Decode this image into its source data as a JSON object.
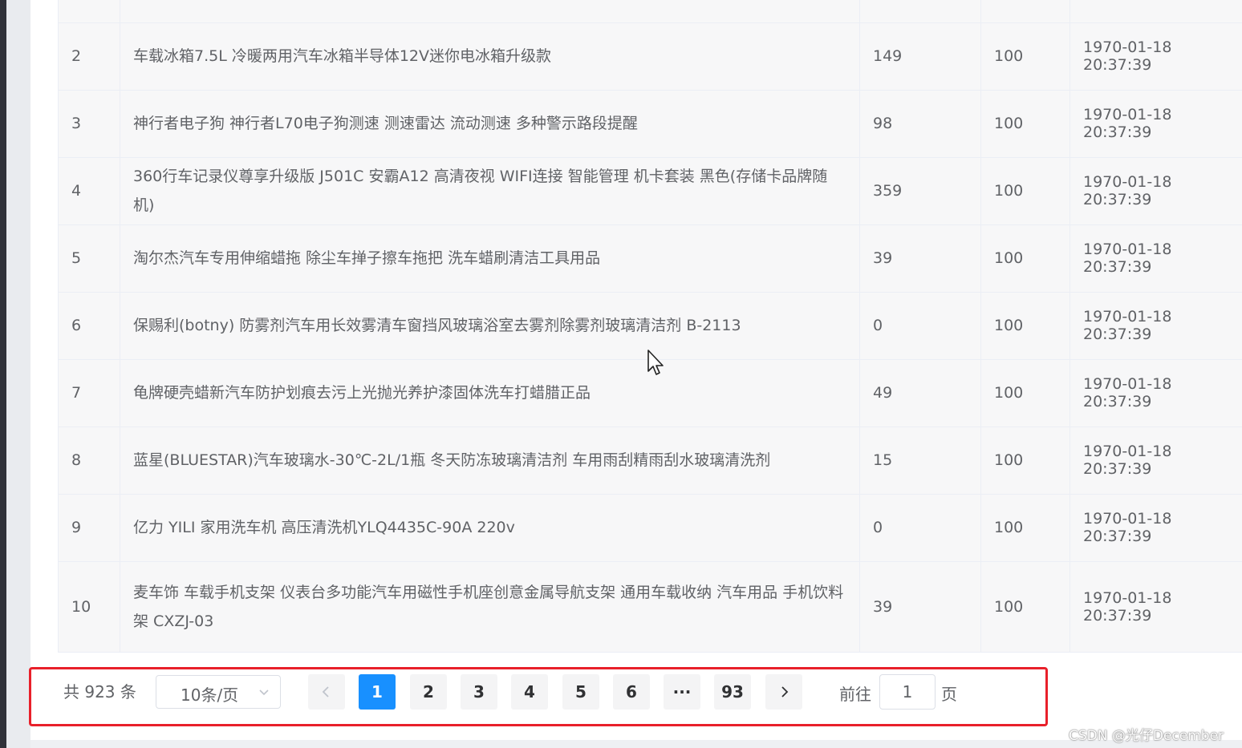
{
  "table": {
    "rows": [
      {
        "idx": "",
        "name": "",
        "price": "",
        "stock": "",
        "time": ""
      },
      {
        "idx": "2",
        "name": "车载冰箱7.5L 冷暖两用汽车冰箱半导体12V迷你电冰箱升级款",
        "price": "149",
        "stock": "100",
        "time": "1970-01-18 20:37:39"
      },
      {
        "idx": "3",
        "name": "神行者电子狗 神行者L70电子狗测速 测速雷达 流动测速 多种警示路段提醒",
        "price": "98",
        "stock": "100",
        "time": "1970-01-18 20:37:39"
      },
      {
        "idx": "4",
        "name": "360行车记录仪尊享升级版 J501C 安霸A12 高清夜视 WIFI连接 智能管理 机卡套装 黑色(存储卡品牌随机)",
        "price": "359",
        "stock": "100",
        "time": "1970-01-18 20:37:39"
      },
      {
        "idx": "5",
        "name": "淘尔杰汽车专用伸缩蜡拖 除尘车掸子擦车拖把 洗车蜡刷清洁工具用品",
        "price": "39",
        "stock": "100",
        "time": "1970-01-18 20:37:39"
      },
      {
        "idx": "6",
        "name": "保赐利(botny) 防雾剂汽车用长效雾清车窗挡风玻璃浴室去雾剂除雾剂玻璃清洁剂 B-2113",
        "price": "0",
        "stock": "100",
        "time": "1970-01-18 20:37:39"
      },
      {
        "idx": "7",
        "name": "龟牌硬壳蜡新汽车防护划痕去污上光抛光养护漆固体洗车打蜡腊正品",
        "price": "49",
        "stock": "100",
        "time": "1970-01-18 20:37:39"
      },
      {
        "idx": "8",
        "name": "蓝星(BLUESTAR)汽车玻璃水-30℃-2L/1瓶 冬天防冻玻璃清洁剂 车用雨刮精雨刮水玻璃清洗剂",
        "price": "15",
        "stock": "100",
        "time": "1970-01-18 20:37:39"
      },
      {
        "idx": "9",
        "name": "亿力 YILI 家用洗车机 高压清洗机YLQ4435C-90A 220v",
        "price": "0",
        "stock": "100",
        "time": "1970-01-18 20:37:39"
      },
      {
        "idx": "10",
        "name": "麦车饰 车载手机支架 仪表台多功能汽车用磁性手机座创意金属导航支架 通用车载收纳 汽车用品 手机饮料架 CXZJ-03",
        "price": "39",
        "stock": "100",
        "time": "1970-01-18 20:37:39"
      }
    ]
  },
  "pagination": {
    "total_label": "共 923 条",
    "page_size_label": "10条/页",
    "pages": [
      "1",
      "2",
      "3",
      "4",
      "5",
      "6",
      "···",
      "93"
    ],
    "current_page": "1",
    "goto_prefix": "前往",
    "goto_value": "1",
    "goto_suffix": "页",
    "active_color": "#1890ff",
    "highlight_border_color": "#e8202a"
  },
  "watermark": "CSDN @光仔December",
  "icons": {
    "prev": "chevron-left-icon",
    "next": "chevron-right-icon",
    "select_caret": "chevron-down-icon",
    "cursor": "mouse-pointer-icon"
  }
}
